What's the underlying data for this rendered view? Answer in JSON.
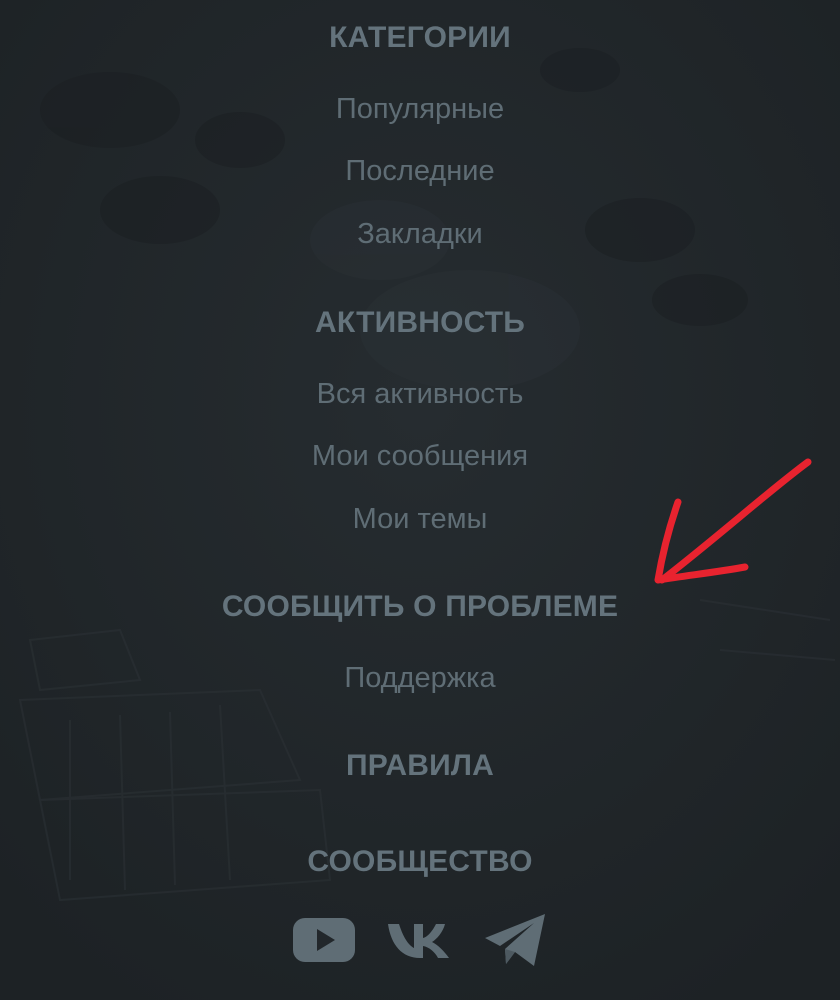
{
  "sections": {
    "categories": {
      "title": "КАТЕГОРИИ",
      "items": [
        "Популярные",
        "Последние",
        "Закладки"
      ]
    },
    "activity": {
      "title": "АКТИВНОСТЬ",
      "items": [
        "Вся активность",
        "Мои сообщения",
        "Мои темы"
      ]
    },
    "report": {
      "title": "СООБЩИТЬ О ПРОБЛЕМЕ",
      "items": [
        "Поддержка"
      ]
    },
    "rules": {
      "title": "ПРАВИЛА"
    },
    "community": {
      "title": "СООБЩЕСТВО"
    }
  },
  "socials": [
    {
      "icon": "youtube-icon"
    },
    {
      "icon": "vk-icon"
    },
    {
      "icon": "telegram-icon"
    }
  ],
  "colors": {
    "background": "#22272b",
    "heading": "#64737c",
    "link": "#5f6d75",
    "annotation": "#e8232f"
  }
}
